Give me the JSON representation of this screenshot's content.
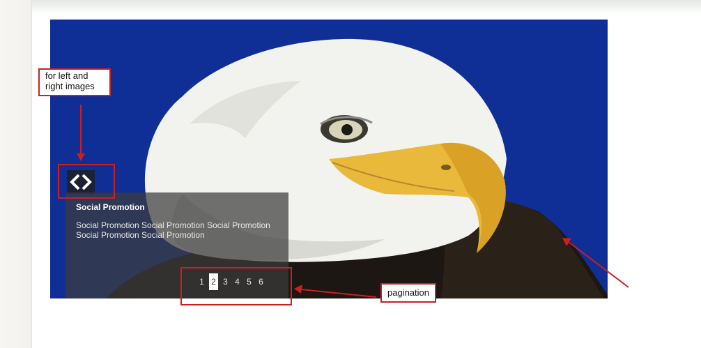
{
  "slider": {
    "caption": {
      "title": "Social Promotion",
      "text": "Social Promotion Social Promotion Social Promotion Social Promotion Social Promotion"
    },
    "pagination": {
      "pages": [
        "1",
        "2",
        "3",
        "4",
        "5",
        "6"
      ],
      "active_page": "2"
    },
    "nav_icon": "left-right-chevron-icon",
    "image_subject": "bald-eagle"
  },
  "annotations": {
    "arrows_note": "for left and right images",
    "pagination_note": "pagination"
  },
  "colors": {
    "annotation_red": "#cc1f1f",
    "sky_blue": "#0f2f96",
    "beak_yellow": "#e8b93a",
    "caption_overlay": "#3c3c3c"
  }
}
